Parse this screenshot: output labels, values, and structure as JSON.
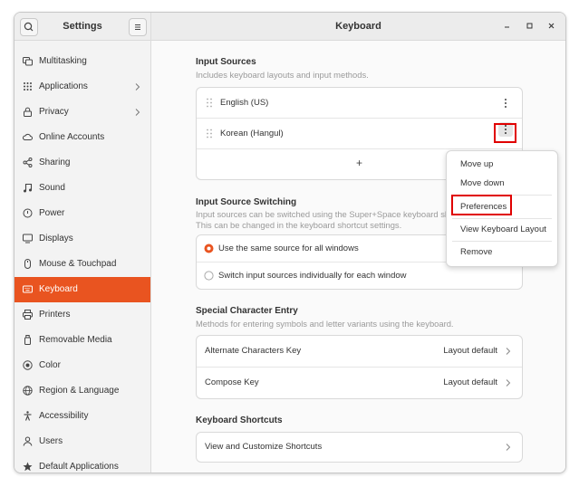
{
  "sidebar": {
    "title": "Settings",
    "items": [
      {
        "label": "Search",
        "icon": "search-icon"
      },
      {
        "label": "Multitasking",
        "icon": "multitasking-icon"
      },
      {
        "label": "Applications",
        "icon": "apps-grid-icon",
        "chevron": true
      },
      {
        "label": "Privacy",
        "icon": "lock-icon",
        "chevron": true
      },
      {
        "label": "Online Accounts",
        "icon": "cloud-icon"
      },
      {
        "label": "Sharing",
        "icon": "share-icon"
      },
      {
        "label": "Sound",
        "icon": "music-note-icon"
      },
      {
        "label": "Power",
        "icon": "power-icon"
      },
      {
        "label": "Displays",
        "icon": "display-icon"
      },
      {
        "label": "Mouse & Touchpad",
        "icon": "mouse-icon"
      },
      {
        "label": "Keyboard",
        "icon": "keyboard-icon",
        "active": true
      },
      {
        "label": "Printers",
        "icon": "printer-icon"
      },
      {
        "label": "Removable Media",
        "icon": "usb-drive-icon"
      },
      {
        "label": "Color",
        "icon": "color-palette-icon"
      },
      {
        "label": "Region & Language",
        "icon": "globe-icon"
      },
      {
        "label": "Accessibility",
        "icon": "accessibility-icon"
      },
      {
        "label": "Users",
        "icon": "users-icon"
      },
      {
        "label": "Default Applications",
        "icon": "star-icon"
      }
    ]
  },
  "header": {
    "title": "Keyboard"
  },
  "input_sources": {
    "title": "Input Sources",
    "subtitle": "Includes keyboard layouts and input methods.",
    "items": [
      "English (US)",
      "Korean (Hangul)"
    ],
    "add_label": "+"
  },
  "switching": {
    "title": "Input Source Switching",
    "subtitle_line1": "Input sources can be switched using the Super+Space keyboard sho",
    "subtitle_line2": "This can be changed in the keyboard shortcut settings.",
    "options": [
      "Use the same source for all windows",
      "Switch input sources individually for each window"
    ],
    "selected": 0
  },
  "special_chars": {
    "title": "Special Character Entry",
    "subtitle": "Methods for entering symbols and letter variants using the keyboard.",
    "rows": [
      {
        "label": "Alternate Characters Key",
        "value": "Layout default"
      },
      {
        "label": "Compose Key",
        "value": "Layout default"
      }
    ]
  },
  "shortcuts": {
    "title": "Keyboard Shortcuts",
    "row_label": "View and Customize Shortcuts"
  },
  "popover": {
    "items": [
      "Move up",
      "Move down",
      "Preferences",
      "View Keyboard Layout",
      "Remove"
    ]
  },
  "colors": {
    "accent": "#e95420",
    "highlight": "#e00000"
  }
}
